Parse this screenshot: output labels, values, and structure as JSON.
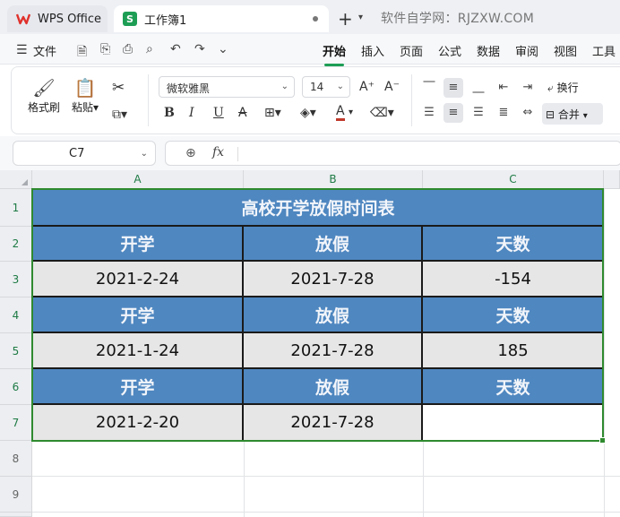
{
  "titlebar": {
    "app_tab": "WPS Office",
    "doc_tab": "工作簿1",
    "doc_icon_letter": "S",
    "watermark": "软件自学网：RJZXW.COM"
  },
  "menubar": {
    "file": "文件",
    "tabs": [
      "开始",
      "插入",
      "页面",
      "公式",
      "数据",
      "审阅",
      "视图",
      "工具"
    ],
    "active_tab": "开始"
  },
  "ribbon": {
    "format_painter": "格式刷",
    "paste": "粘贴",
    "font_name": "微软雅黑",
    "font_size": "14",
    "bold": "B",
    "italic": "I",
    "underline": "U",
    "strike": "A",
    "font_color_letter": "A",
    "increase_font": "A⁺",
    "decrease_font": "A⁻",
    "wrap_text": "换行",
    "merge": "合并"
  },
  "formula_bar": {
    "name_box": "C7",
    "fx": "fx",
    "formula": ""
  },
  "sheet": {
    "columns": [
      "A",
      "B",
      "C"
    ],
    "rows": [
      "1",
      "2",
      "3",
      "4",
      "5",
      "6",
      "7",
      "8",
      "9"
    ],
    "title": "高校开学放假时间表",
    "blocks": [
      {
        "headers": [
          "开学",
          "放假",
          "天数"
        ],
        "values": [
          "2021-2-24",
          "2021-7-28",
          "-154"
        ]
      },
      {
        "headers": [
          "开学",
          "放假",
          "天数"
        ],
        "values": [
          "2021-1-24",
          "2021-7-28",
          "185"
        ]
      },
      {
        "headers": [
          "开学",
          "放假",
          "天数"
        ],
        "values": [
          "2021-2-20",
          "2021-7-28",
          ""
        ]
      }
    ]
  },
  "colors": {
    "header_fill": "#4f87c0",
    "data_fill": "#e6e6e6",
    "selection_border": "#2f8a2f",
    "accent": "#1e9e55"
  }
}
